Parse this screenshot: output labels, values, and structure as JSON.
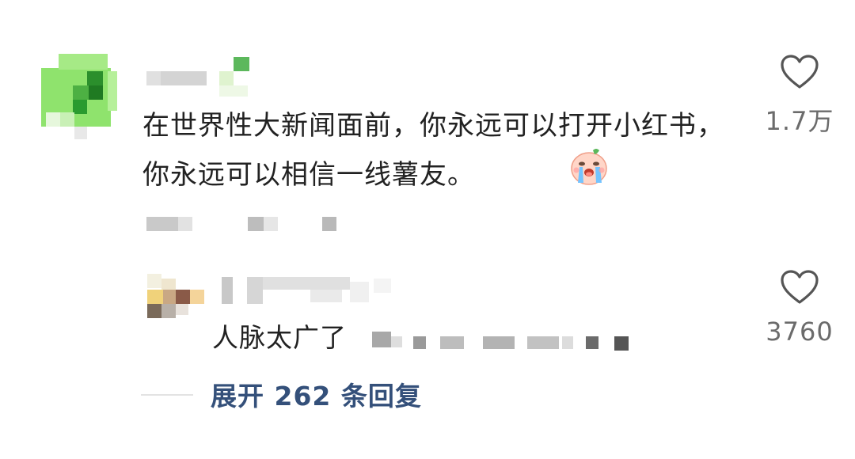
{
  "comment": {
    "text": "在世界性大新闻面前，你永远可以打开小红书，你永远可以相信一线薯友。",
    "emoji_icon": "crying-face-emoji",
    "likes": "1.7万"
  },
  "reply": {
    "text": "人脉太广了",
    "likes": "3760"
  },
  "expand": {
    "label": "展开 262 条回复"
  },
  "colors": {
    "expand_link": "#34507a",
    "like_count": "#6b6b6b",
    "avatar_green": "#8fe06a"
  }
}
